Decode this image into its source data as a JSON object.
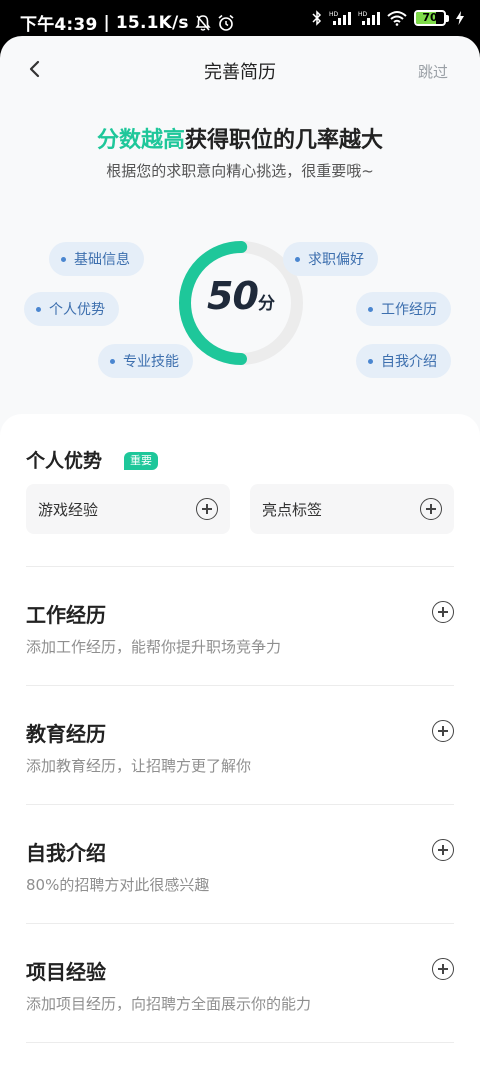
{
  "status_bar": {
    "time": "下午4:39",
    "separator": "|",
    "speed": "15.1K/s",
    "battery": "70",
    "battery_fraction": 0.7
  },
  "nav": {
    "title": "完善简历",
    "skip_label": "跳过"
  },
  "headline": {
    "highlight": "分数越高",
    "rest": "获得职位的几率越大",
    "subtitle": "根据您的求职意向精心挑选，很重要哦~"
  },
  "score": {
    "value": "50",
    "unit": "分",
    "progress": 0.5,
    "accent_color": "#1ec79a",
    "track_color": "#ececec"
  },
  "tags": [
    "基础信息",
    "求职偏好",
    "个人优势",
    "工作经历",
    "专业技能",
    "自我介绍"
  ],
  "advantage": {
    "title": "个人优势",
    "badge": "重要",
    "items": [
      "游戏经验",
      "亮点标签"
    ]
  },
  "sections": [
    {
      "title": "工作经历",
      "desc": "添加工作经历，能帮你提升职场竞争力"
    },
    {
      "title": "教育经历",
      "desc": "添加教育经历，让招聘方更了解你"
    },
    {
      "title": "自我介绍",
      "desc": "80%的招聘方对此很感兴趣"
    },
    {
      "title": "项目经验",
      "desc": "添加项目经历，向招聘方全面展示你的能力"
    }
  ]
}
